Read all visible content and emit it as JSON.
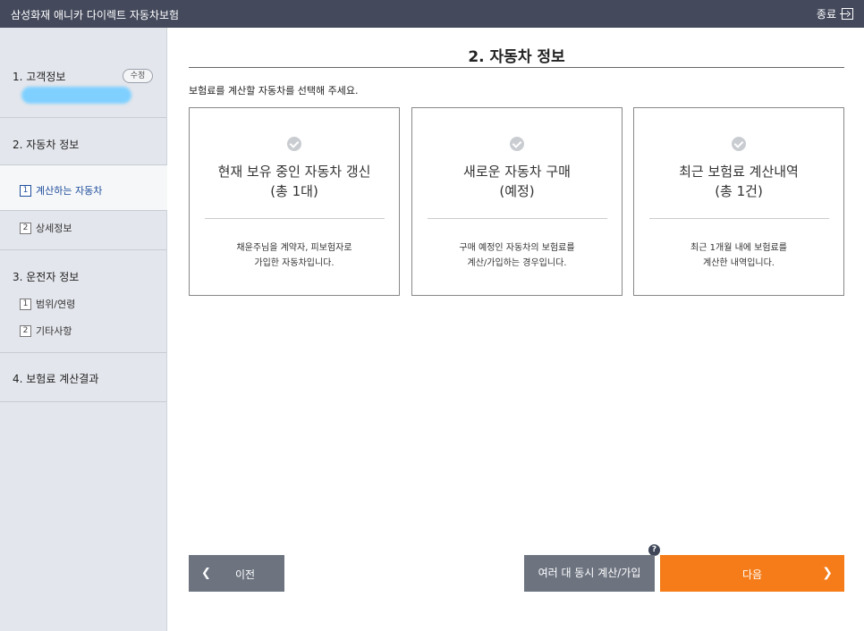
{
  "app": {
    "title": "삼성화재 애니카 다이렉트 자동차보험",
    "exit_label": "종료"
  },
  "sidebar": {
    "section1": {
      "label": "1. 고객정보",
      "edit_label": "수정"
    },
    "section2": {
      "label": "2. 자동차 정보",
      "items": [
        {
          "num": "1",
          "label": "계산하는 자동차"
        },
        {
          "num": "2",
          "label": "상세정보"
        }
      ]
    },
    "section3": {
      "label": "3. 운전자 정보",
      "items": [
        {
          "num": "1",
          "label": "범위/연령"
        },
        {
          "num": "2",
          "label": "기타사항"
        }
      ]
    },
    "section4": {
      "label": "4. 보험료 계산결과"
    }
  },
  "main": {
    "title": "2. 자동차 정보",
    "instruction": "보험료를 계산할 자동차를 선택해 주세요.",
    "cards": [
      {
        "title_line1": "현재 보유 중인 자동차 갱신",
        "title_line2": "(총 1대)",
        "desc_line1": "채윤주님을 계약자, 피보험자로",
        "desc_line2": "가입한 자동차입니다."
      },
      {
        "title_line1": "새로운 자동차 구매",
        "title_line2": "(예정)",
        "desc_line1": "구매 예정인 자동차의 보험료를",
        "desc_line2": "계산/가입하는 경우입니다."
      },
      {
        "title_line1": "최근 보험료 계산내역",
        "title_line2": "(총 1건)",
        "desc_line1": "최근 1개월 내에 보험료를",
        "desc_line2": "계산한 내역입니다."
      }
    ]
  },
  "footer": {
    "prev_label": "이전",
    "multi_label": "여러 대 동시 계산/가입",
    "next_label": "다음",
    "help_label": "?"
  },
  "colors": {
    "topbar": "#444a5c",
    "accent": "#f57c18",
    "sidebar_bg": "#e3e6ec",
    "active_text": "#1f4e9c",
    "button_gray": "#6d7480"
  }
}
